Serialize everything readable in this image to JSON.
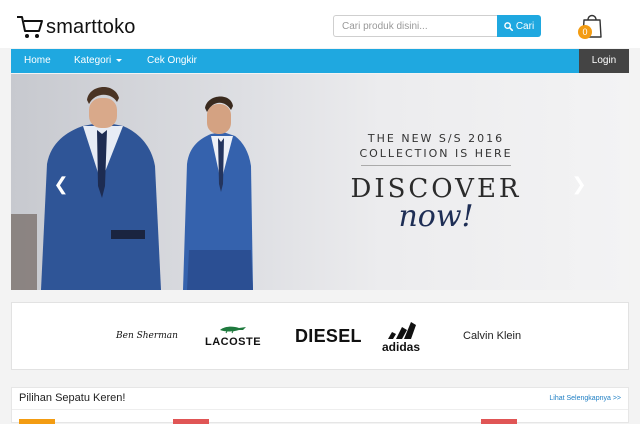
{
  "header": {
    "logo_text": "smarttoko",
    "search": {
      "placeholder": "Cari produk disini...",
      "button_label": "Cari"
    },
    "cart": {
      "count": "0"
    }
  },
  "nav": {
    "items": [
      {
        "label": "Home"
      },
      {
        "label": "Kategori"
      },
      {
        "label": "Cek Ongkir"
      }
    ],
    "login_label": "Login"
  },
  "banner": {
    "line1": "THE NEW S/S 2016",
    "line2": "COLLECTION IS HERE",
    "line3": "DISCOVER",
    "line4": "now!"
  },
  "brands": [
    "Ben Sherman",
    "LACOSTE",
    "DIESEL",
    "adidas",
    "Calvin Klein"
  ],
  "section": {
    "title": "Pilihan Sepatu Keren!",
    "link": "Lihat Selengkapnya >>"
  },
  "colors": {
    "accent": "#1fa8e0",
    "login_bg": "#444444",
    "badge": "#f39c12",
    "tag_orange": "#f39c12",
    "tag_red": "#e05555"
  }
}
